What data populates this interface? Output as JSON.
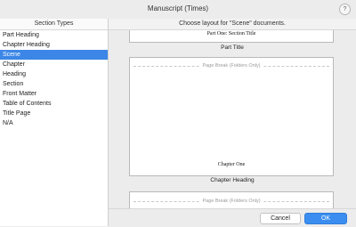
{
  "window": {
    "title": "Manuscript (Times)",
    "help_label": "?"
  },
  "sidebar": {
    "header": "Section Types",
    "items": [
      {
        "label": "Part Heading"
      },
      {
        "label": "Chapter Heading"
      },
      {
        "label": "Scene"
      },
      {
        "label": "Chapter"
      },
      {
        "label": "Heading"
      },
      {
        "label": "Section"
      },
      {
        "label": "Front Matter"
      },
      {
        "label": "Table of Contents"
      },
      {
        "label": "Title Page"
      },
      {
        "label": "N/A"
      }
    ],
    "selected": "Scene"
  },
  "main": {
    "header": "Choose layout for \"Scene\" documents.",
    "layouts": [
      {
        "name": "Part Title",
        "heading_text": "Part One: Section Title"
      },
      {
        "name": "Chapter Heading",
        "page_break_label": "Page Break (Folders Only)",
        "heading_text": "Chapter One"
      },
      {
        "page_break_label": "Page Break (Folders Only)"
      }
    ]
  },
  "footer": {
    "cancel_label": "Cancel",
    "ok_label": "OK"
  },
  "colors": {
    "selection": "#3b86e6",
    "ok_button": "#3b8ef0"
  }
}
